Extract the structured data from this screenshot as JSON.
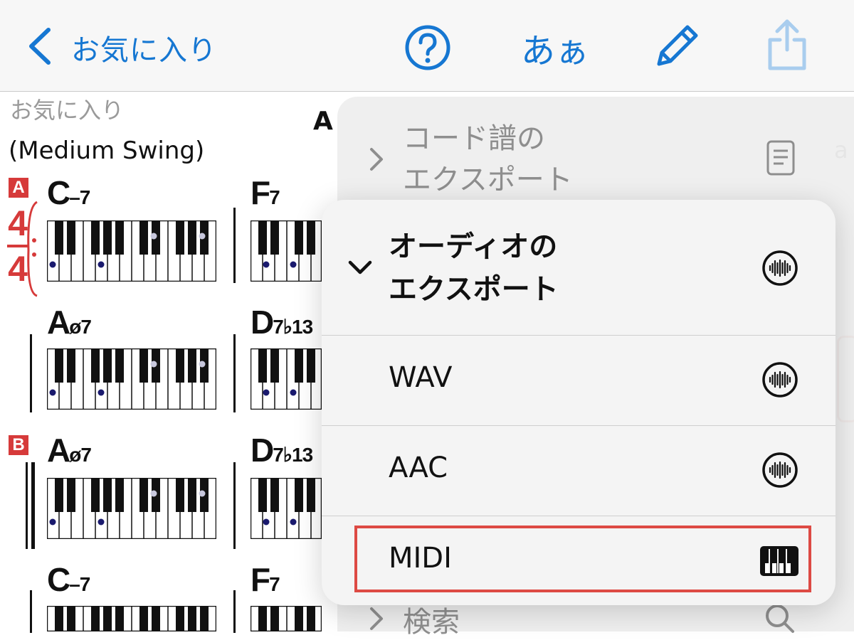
{
  "nav": {
    "back_label": "お気に入り",
    "font_size_label": "あぁ",
    "icons": [
      "chevron-left-icon",
      "help-icon",
      "pencil-icon",
      "share-icon"
    ],
    "accent_color": "#1677d2"
  },
  "sheet": {
    "folder": "お気に入り",
    "style": "(Medium Swing)",
    "title_fragment": "A",
    "edge_fragment": "a",
    "section_a": "A",
    "section_b": "B",
    "time_sig_top": "4",
    "time_sig_bottom": "4",
    "rows": [
      {
        "c1_root": "C",
        "c1_qual": "–7",
        "c2_root": "F",
        "c2_qual": "7"
      },
      {
        "c1_root": "A",
        "c1_qual": "ø7",
        "c2_root": "D",
        "c2_qual": "7♭13"
      },
      {
        "c1_root": "A",
        "c1_qual": "ø7",
        "c2_root": "D",
        "c2_qual": "7♭13"
      },
      {
        "c1_root": "C",
        "c1_qual": "–7",
        "c2_root": "F",
        "c2_qual": "7"
      }
    ],
    "accent_color": "#d63a3a"
  },
  "menu": {
    "chord_export": "コード譜の\nエクスポート",
    "audio_export_line1": "オーディオの",
    "audio_export_line2": "エクスポート",
    "items": [
      {
        "label": "WAV",
        "icon": "waveform-icon"
      },
      {
        "label": "AAC",
        "icon": "waveform-icon"
      },
      {
        "label": "MIDI",
        "icon": "piano-keys-icon",
        "highlighted": true
      }
    ],
    "search": "検索",
    "chord_export_icon": "document-icon",
    "search_icon": "search-icon",
    "highlight_color": "#dd4a44"
  }
}
